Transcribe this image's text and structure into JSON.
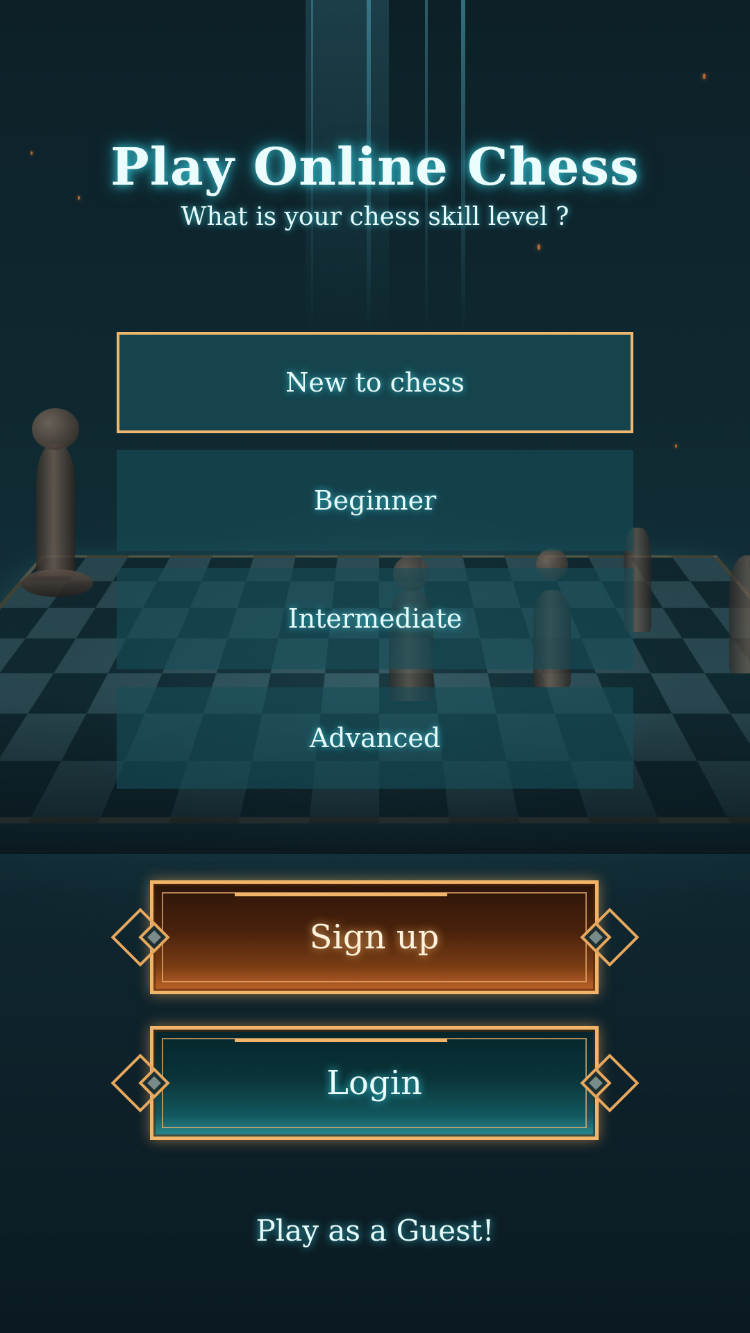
{
  "header": {
    "title": "Play Online Chess",
    "subtitle": "What is your chess skill level ?"
  },
  "levels": {
    "selected": "New to chess",
    "items": [
      {
        "label": "New to chess"
      },
      {
        "label": "Beginner"
      },
      {
        "label": "Intermediate"
      },
      {
        "label": "Advanced"
      }
    ]
  },
  "actions": {
    "signup_label": "Sign up",
    "login_label": "Login",
    "guest_label": "Play as a Guest!"
  },
  "colors": {
    "accent_gold": "#f0b86e",
    "glow_cyan": "#3cdceb",
    "signup_fill": "#7a3d14",
    "login_fill": "#12575e",
    "option_fill": "#164e58"
  },
  "background": {
    "scene": "chessboard-with-pieces"
  }
}
